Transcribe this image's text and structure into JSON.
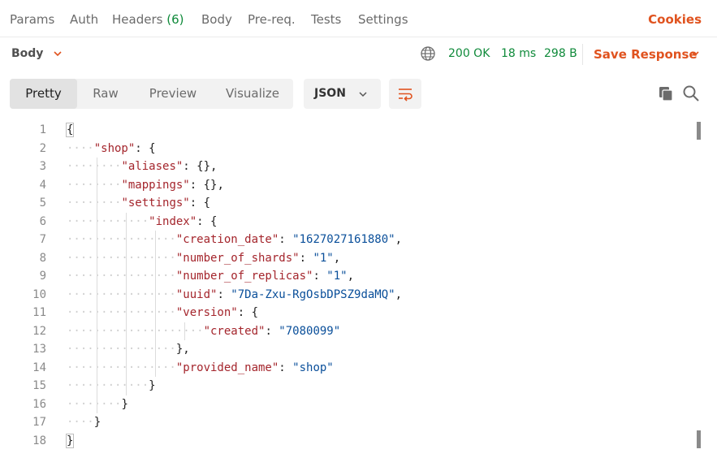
{
  "tabs": [
    {
      "label": "Params"
    },
    {
      "label": "Auth"
    },
    {
      "label": "Headers",
      "count": "(6)"
    },
    {
      "label": "Body"
    },
    {
      "label": "Pre-req."
    },
    {
      "label": "Tests"
    },
    {
      "label": "Settings"
    }
  ],
  "cookies_label": "Cookies",
  "response": {
    "body_label": "Body",
    "status": "200 OK",
    "time": "18 ms",
    "size": "298 B",
    "save_label": "Save Response"
  },
  "view_modes": [
    {
      "label": "Pretty",
      "active": true
    },
    {
      "label": "Raw"
    },
    {
      "label": "Preview"
    },
    {
      "label": "Visualize"
    }
  ],
  "format": {
    "selected": "JSON"
  },
  "colors": {
    "accent": "#e0531f",
    "status_ok": "#0f8a3a",
    "json_key": "#a4252c",
    "json_string": "#0a4f9a"
  },
  "icons": [
    "chevron-down-icon",
    "globe-icon",
    "wrap-lines-icon",
    "copy-icon",
    "search-icon"
  ],
  "code_lines": [
    {
      "n": "1",
      "indent": 0,
      "parts": [
        [
          "pun",
          "{"
        ]
      ]
    },
    {
      "n": "2",
      "indent": 1,
      "parts": [
        [
          "key",
          "\"shop\""
        ],
        [
          "pun",
          ": {"
        ]
      ]
    },
    {
      "n": "3",
      "indent": 2,
      "parts": [
        [
          "key",
          "\"aliases\""
        ],
        [
          "pun",
          ": {},"
        ]
      ]
    },
    {
      "n": "4",
      "indent": 2,
      "parts": [
        [
          "key",
          "\"mappings\""
        ],
        [
          "pun",
          ": {},"
        ]
      ]
    },
    {
      "n": "5",
      "indent": 2,
      "parts": [
        [
          "key",
          "\"settings\""
        ],
        [
          "pun",
          ": {"
        ]
      ]
    },
    {
      "n": "6",
      "indent": 3,
      "parts": [
        [
          "key",
          "\"index\""
        ],
        [
          "pun",
          ": {"
        ]
      ]
    },
    {
      "n": "7",
      "indent": 4,
      "parts": [
        [
          "key",
          "\"creation_date\""
        ],
        [
          "pun",
          ": "
        ],
        [
          "str",
          "\"1627027161880\""
        ],
        [
          "pun",
          ","
        ]
      ]
    },
    {
      "n": "8",
      "indent": 4,
      "parts": [
        [
          "key",
          "\"number_of_shards\""
        ],
        [
          "pun",
          ": "
        ],
        [
          "str",
          "\"1\""
        ],
        [
          "pun",
          ","
        ]
      ]
    },
    {
      "n": "9",
      "indent": 4,
      "parts": [
        [
          "key",
          "\"number_of_replicas\""
        ],
        [
          "pun",
          ": "
        ],
        [
          "str",
          "\"1\""
        ],
        [
          "pun",
          ","
        ]
      ]
    },
    {
      "n": "10",
      "indent": 4,
      "parts": [
        [
          "key",
          "\"uuid\""
        ],
        [
          "pun",
          ": "
        ],
        [
          "str",
          "\"7Da-Zxu-RgOsbDPSZ9daMQ\""
        ],
        [
          "pun",
          ","
        ]
      ]
    },
    {
      "n": "11",
      "indent": 4,
      "parts": [
        [
          "key",
          "\"version\""
        ],
        [
          "pun",
          ": {"
        ]
      ]
    },
    {
      "n": "12",
      "indent": 5,
      "parts": [
        [
          "key",
          "\"created\""
        ],
        [
          "pun",
          ": "
        ],
        [
          "str",
          "\"7080099\""
        ]
      ]
    },
    {
      "n": "13",
      "indent": 4,
      "parts": [
        [
          "pun",
          "},"
        ]
      ]
    },
    {
      "n": "14",
      "indent": 4,
      "parts": [
        [
          "key",
          "\"provided_name\""
        ],
        [
          "pun",
          ": "
        ],
        [
          "str",
          "\"shop\""
        ]
      ]
    },
    {
      "n": "15",
      "indent": 3,
      "parts": [
        [
          "pun",
          "}"
        ]
      ]
    },
    {
      "n": "16",
      "indent": 2,
      "parts": [
        [
          "pun",
          "}"
        ]
      ]
    },
    {
      "n": "17",
      "indent": 1,
      "parts": [
        [
          "pun",
          "}"
        ]
      ]
    },
    {
      "n": "18",
      "indent": 0,
      "parts": [
        [
          "pun",
          "}"
        ]
      ]
    }
  ]
}
